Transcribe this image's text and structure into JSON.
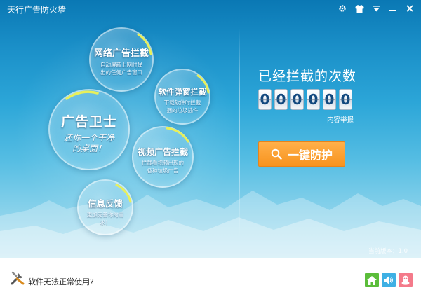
{
  "window": {
    "title": "天行广告防火墙",
    "icons": [
      "gear-icon",
      "skin-icon",
      "menu-icon",
      "minimize-icon",
      "close-icon"
    ]
  },
  "bubbles": {
    "net": {
      "title": "网络广告拦截",
      "desc": "自动屏蔽上网时弹出的任何广告窗口"
    },
    "guard": {
      "title": "广告卫士",
      "desc": "还你一个干净的桌面！"
    },
    "popup": {
      "title": "软件弹窗拦截",
      "desc": "下载软件时拦截捆的垃圾插件"
    },
    "video": {
      "title": "视频广告拦截",
      "desc": "拦截看视频出现的各种垃圾广告"
    },
    "feedback": {
      "title": "信息反馈",
      "desc": "更加完善你的需求！"
    }
  },
  "counter": {
    "title": "已经拦截的次数",
    "digits": [
      "0",
      "0",
      "0",
      "0",
      "0",
      "0"
    ],
    "report_link": "内容举报"
  },
  "protect_button": {
    "label": "一键防护",
    "icon": "search-icon"
  },
  "version": "当前版本：1.0",
  "footer": {
    "help_text": "软件无法正常使用?",
    "buttons": [
      "home-icon",
      "sound-icon",
      "qq-icon"
    ]
  },
  "colors": {
    "accent_orange": "#f7931e",
    "digit_text": "#11487e",
    "home_green": "#5bbd3a",
    "sound_blue": "#3eb0e4",
    "qq_pink": "#f47a8a"
  }
}
